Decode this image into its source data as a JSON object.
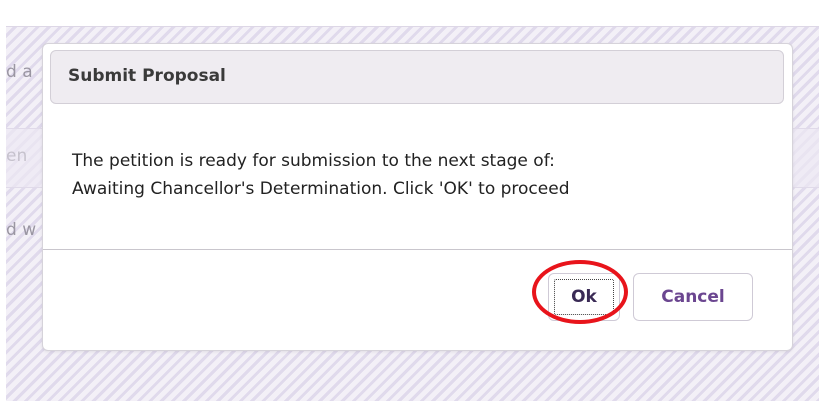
{
  "background": {
    "row_texts": [
      "d a",
      "en",
      "d w"
    ]
  },
  "dialog": {
    "title": "Submit Proposal",
    "message_line1": "The petition is ready for submission to the next stage of:",
    "message_line2": "Awaiting Chancellor's Determination. Click 'OK' to proceed",
    "ok_label": "Ok",
    "cancel_label": "Cancel"
  },
  "colors": {
    "accent": "#6b4690",
    "annotation": "#e8141b",
    "backdrop": "#f3f0f7"
  }
}
